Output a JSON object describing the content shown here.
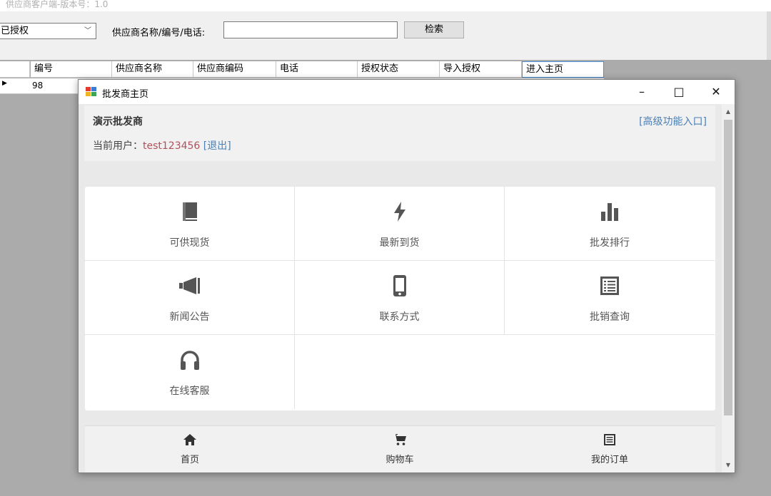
{
  "app": {
    "title": "供应商客户端-版本号：1.0"
  },
  "toolbar": {
    "status_value": "已授权",
    "search_label": "供应商名称/编号/电话:",
    "search_value": "",
    "search_button": "检索"
  },
  "grid": {
    "columns": [
      "编号",
      "供应商名称",
      "供应商编码",
      "电话",
      "授权状态",
      "导入授权",
      "进入主页"
    ],
    "rows": [
      {
        "id": "98"
      }
    ]
  },
  "modal": {
    "title": "批发商主页",
    "minimize": "–",
    "maximize": "□",
    "close": "✕",
    "merchant_name": "演示批发商",
    "advanced_link": "[高级功能入口]",
    "user_label": "当前用户：",
    "username": "test123456",
    "logout": "[退出]",
    "menu": [
      {
        "label": "可供现货",
        "icon": "book-icon"
      },
      {
        "label": "最新到货",
        "icon": "bolt-icon"
      },
      {
        "label": "批发排行",
        "icon": "bar-chart-icon"
      },
      {
        "label": "新闻公告",
        "icon": "megaphone-icon"
      },
      {
        "label": "联系方式",
        "icon": "phone-icon"
      },
      {
        "label": "批销查询",
        "icon": "list-icon"
      },
      {
        "label": "在线客服",
        "icon": "headphones-icon"
      }
    ],
    "tabs": [
      {
        "label": "首页",
        "icon": "home-icon"
      },
      {
        "label": "购物车",
        "icon": "cart-icon"
      },
      {
        "label": "我的订单",
        "icon": "order-list-icon"
      }
    ]
  },
  "colors": {
    "link": "#4a7fb5",
    "username": "#b2505a",
    "icon": "#555555"
  }
}
